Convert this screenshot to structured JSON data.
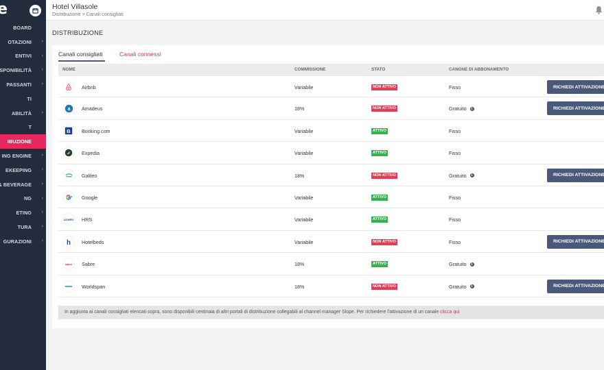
{
  "app": {
    "logo_text": "e",
    "hotel_name": "Hotel Villasole",
    "breadcrumb": "Distribuzione > Canali consigliati",
    "section_title": "DISTRIBUZIONE"
  },
  "sidebar": {
    "items": [
      {
        "label": "BOARD",
        "chevron": false,
        "active": false
      },
      {
        "label": "OTAZIONI",
        "chevron": true,
        "active": false
      },
      {
        "label": "ENTIVI",
        "chevron": true,
        "active": false
      },
      {
        "label": "E DISPONIBILITÀ",
        "chevron": true,
        "active": false
      },
      {
        "label": "PASSANTI",
        "chevron": true,
        "active": false
      },
      {
        "label": "TI",
        "chevron": false,
        "active": false
      },
      {
        "label": "ABILITÀ",
        "chevron": true,
        "active": false
      },
      {
        "label": "T",
        "chevron": false,
        "active": false
      },
      {
        "label": "IBUZIONE",
        "chevron": false,
        "active": true
      },
      {
        "label": "ING ENGINE",
        "chevron": true,
        "active": false
      },
      {
        "label": "EKEEPING",
        "chevron": true,
        "active": false
      },
      {
        "label": "& BEVERAGE",
        "chevron": true,
        "active": false
      },
      {
        "label": "NG",
        "chevron": true,
        "active": false
      },
      {
        "label": "ETING",
        "chevron": true,
        "active": false
      },
      {
        "label": "TURA",
        "chevron": true,
        "active": false
      },
      {
        "label": "GURAZIONI",
        "chevron": true,
        "active": false
      }
    ]
  },
  "tabs": [
    {
      "label": "Canali consigliati",
      "active": true
    },
    {
      "label": "Canali connessi",
      "active": false
    }
  ],
  "table": {
    "headers": {
      "name": "NOME",
      "commission": "COMMISSIONE",
      "status": "STATO",
      "fee": "CANONE DI ABBONAMENTO"
    },
    "rows": [
      {
        "name": "Airbnb",
        "icon": "airbnb-logo",
        "commission": "Variabile",
        "status": "NON ATTIVO",
        "active": false,
        "fee": "Fisso",
        "info": false,
        "button": "RICHIEDI ATTIVAZIONE"
      },
      {
        "name": "Amadeus",
        "icon": "amadeus-logo",
        "commission": "18%",
        "status": "NON ATTIVO",
        "active": false,
        "fee": "Gratuito",
        "info": true,
        "button": "RICHIEDI ATTIVAZIONE"
      },
      {
        "name": "Booking.com",
        "icon": "booking-logo",
        "commission": "Variabile",
        "status": "ATTIVO",
        "active": true,
        "fee": "Fisso",
        "info": false,
        "button": ""
      },
      {
        "name": "Expedia",
        "icon": "expedia-logo",
        "commission": "Variabile",
        "status": "ATTIVO",
        "active": true,
        "fee": "Fisso",
        "info": false,
        "button": ""
      },
      {
        "name": "Galileo",
        "icon": "galileo-logo",
        "commission": "18%",
        "status": "NON ATTIVO",
        "active": false,
        "fee": "Gratuito",
        "info": true,
        "button": "RICHIEDI ATTIVAZIONE"
      },
      {
        "name": "Google",
        "icon": "google-logo",
        "commission": "Variabile",
        "status": "ATTIVO",
        "active": true,
        "fee": "Fisso",
        "info": false,
        "button": ""
      },
      {
        "name": "HRS",
        "icon": "hrs-logo",
        "commission": "Variabile",
        "status": "ATTIVO",
        "active": true,
        "fee": "Fisso",
        "info": false,
        "button": ""
      },
      {
        "name": "Hotelbeds",
        "icon": "hotelbeds-logo",
        "commission": "Variabile",
        "status": "NON ATTIVO",
        "active": false,
        "fee": "Fisso",
        "info": false,
        "button": "RICHIEDI ATTIVAZIONE"
      },
      {
        "name": "Sabre",
        "icon": "sabre-logo",
        "commission": "18%",
        "status": "ATTIVO",
        "active": true,
        "fee": "Gratuito",
        "info": true,
        "button": ""
      },
      {
        "name": "Worldspan",
        "icon": "worldspan-logo",
        "commission": "18%",
        "status": "NON ATTIVO",
        "active": false,
        "fee": "Gratuito",
        "info": true,
        "button": "RICHIEDI ATTIVAZIONE"
      }
    ]
  },
  "footer": {
    "text": "In aggiunta ai canali consigliati elencati sopra, sono disponibili centinaia di altri portali di distribuzione collegabili al channel manager Slope. Per richiedere l'attivazione di un canale",
    "link": "clicca qui"
  },
  "colors": {
    "accent": "#e6285f",
    "sidebar_bg": "#232c3d",
    "button_bg": "#4a5979",
    "badge_active": "#37b04e",
    "badge_inactive": "#e23d52"
  }
}
